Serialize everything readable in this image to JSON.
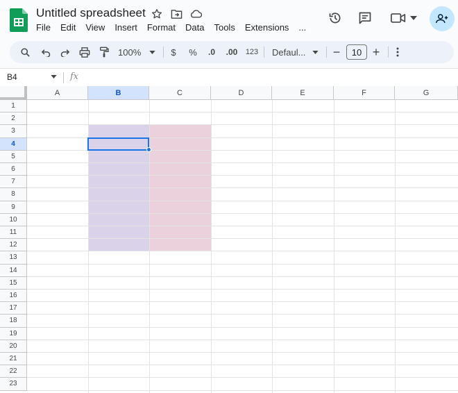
{
  "doc": {
    "title": "Untitled spreadsheet",
    "menu": [
      "File",
      "Edit",
      "View",
      "Insert",
      "Format",
      "Data",
      "Tools",
      "Extensions",
      "..."
    ]
  },
  "toolbar": {
    "zoom": "100%",
    "currency": "$",
    "percent": "%",
    "decrease_decimal": ".0",
    "increase_decimal": ".00",
    "number_format": "123",
    "font": "Defaul...",
    "font_size": "10",
    "minus": "−",
    "plus": "+"
  },
  "formula_bar": {
    "cell_ref": "B4",
    "fx_label": "fx"
  },
  "grid": {
    "columns": [
      "A",
      "B",
      "C",
      "D",
      "E",
      "F",
      "G"
    ],
    "selected_column": "B",
    "rows": [
      "1",
      "2",
      "3",
      "4",
      "5",
      "6",
      "7",
      "8",
      "9",
      "10",
      "11",
      "12",
      "13",
      "14",
      "15",
      "16",
      "17",
      "18",
      "19",
      "20",
      "21",
      "22",
      "23"
    ],
    "selected_row": "4",
    "active_cell": "B4",
    "filled_ranges": [
      {
        "range": "B3:B12",
        "color": "#d9d2e9"
      },
      {
        "range": "C3:C12",
        "color": "#ead1dc"
      }
    ]
  },
  "colors": {
    "accent": "#1a73e8",
    "selected_header": "#d3e3fd",
    "share_button": "#c2e7ff",
    "logo_green": "#0f9d58"
  }
}
